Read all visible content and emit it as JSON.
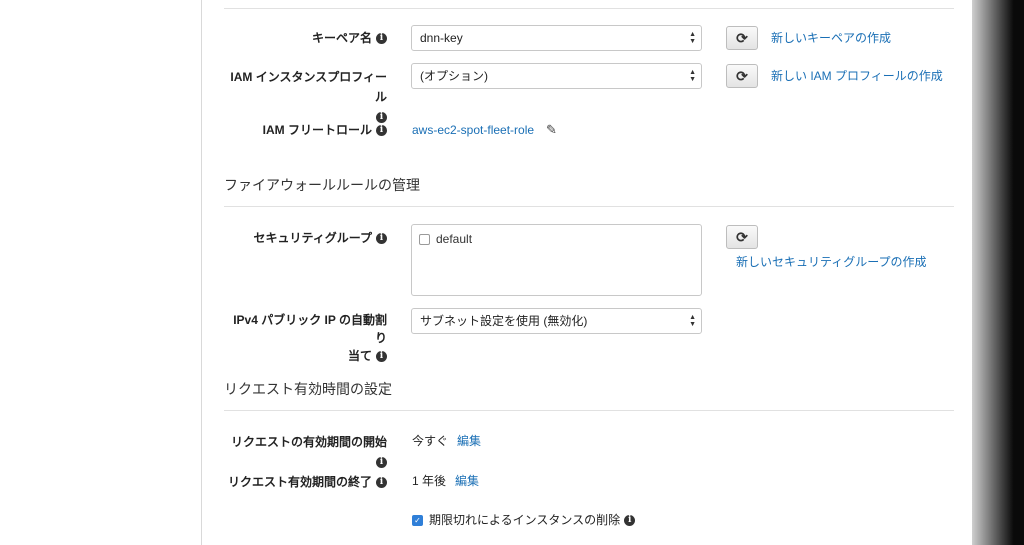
{
  "keypair": {
    "label": "キーペア名",
    "value": "dnn-key",
    "create_link": "新しいキーペアの作成"
  },
  "iam_profile": {
    "label_line1": "IAM インスタンスプロフィール",
    "value": "(オプション)",
    "create_link": "新しい IAM プロフィールの作成"
  },
  "iam_fleet_role": {
    "label": "IAM フリートロール",
    "value": "aws-ec2-spot-fleet-role"
  },
  "firewall_section": {
    "title": "ファイアウォールルールの管理"
  },
  "security_group": {
    "label": "セキュリティグループ",
    "options": [
      {
        "name": "default",
        "checked": false
      }
    ],
    "create_link": "新しいセキュリティグループの作成"
  },
  "public_ip": {
    "label_line1": "IPv4 パブリック IP の自動割り",
    "label_line2": "当て",
    "value": "サブネット設定を使用 (無効化)"
  },
  "request_section": {
    "title": "リクエスト有効時間の設定"
  },
  "request_start": {
    "label": "リクエストの有効期間の開始",
    "value": "今すぐ",
    "edit": "編集"
  },
  "request_end": {
    "label": "リクエスト有効期間の終了",
    "value": "1 年後",
    "edit": "編集"
  },
  "terminate_on_expire": {
    "label": "期限切れによるインスタンスの削除",
    "checked": true
  },
  "icons": {
    "info": "i",
    "refresh": "⟳",
    "pencil": "✎",
    "select_arrows": "▲▼",
    "check": "✓"
  }
}
